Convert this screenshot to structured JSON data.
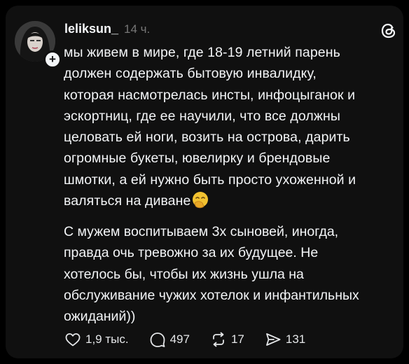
{
  "post": {
    "username": "leliksun_",
    "time": "14 ч.",
    "paragraph1_lines": [
      "мы живем в мире, где 18-19 летний парень",
      "должен содержать бытовую инвалидку,",
      "которая насмотрелась инсты, инфоцыганок и",
      "эскортниц, где ее научили, что все должны",
      "целовать ей ноги, возить на острова, дарить",
      "огромные букеты, ювелирку и брендовые",
      "шмотки, а ей нужно быть просто ухоженной и",
      "валяться на диване"
    ],
    "paragraph2_lines": [
      "С мужем воспитываем 3х сыновей, иногда,",
      "правда очь тревожно за их будущее. Не",
      "хотелось бы, чтобы их жизнь ушла на",
      "обслуживание чужих хотелок и инфантильных",
      "ожиданий))"
    ],
    "emoji": "face-with-hand-over-mouth-emoji"
  },
  "actions": {
    "likes": "1,9 тыс.",
    "comments": "497",
    "reposts": "17",
    "shares": "131"
  },
  "icons": {
    "logo": "threads-logo-icon",
    "like": "heart-icon",
    "comment": "comment-bubble-icon",
    "repost": "repost-icon",
    "share": "send-icon",
    "follow": "plus-icon"
  },
  "colors": {
    "background": "#101010",
    "text": "#f3f5f7",
    "muted": "#777777",
    "emoji": "#f2c230"
  }
}
